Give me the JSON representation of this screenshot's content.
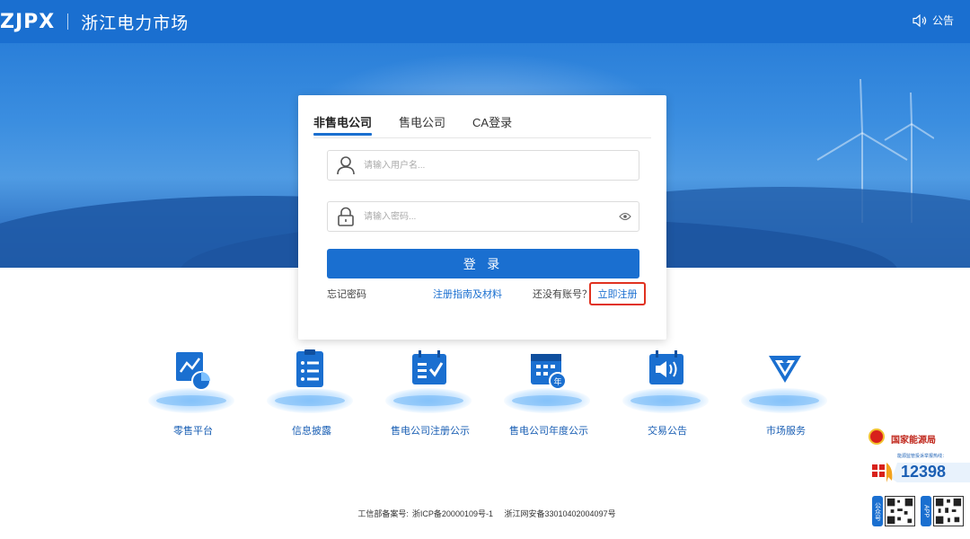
{
  "header": {
    "logo": "ZJPX",
    "site_name": "浙江电力市场",
    "notice_label": "公告"
  },
  "login": {
    "tabs": [
      {
        "label": "非售电公司",
        "active": true
      },
      {
        "label": "售电公司",
        "active": false
      },
      {
        "label": "CA登录",
        "active": false
      }
    ],
    "username_placeholder": "请输入用户名...",
    "password_placeholder": "请输入密码...",
    "submit_label": "登 录",
    "forgot_label": "忘记密码",
    "guide_label": "注册指南及材料",
    "no_account_label": "还没有账号？",
    "register_label": "立即注册"
  },
  "features": [
    {
      "label": "零售平台",
      "icon": "chart-pie-icon"
    },
    {
      "label": "信息披露",
      "icon": "clipboard-list-icon"
    },
    {
      "label": "售电公司注册公示",
      "icon": "checklist-icon"
    },
    {
      "label": "售电公司年度公示",
      "icon": "calendar-year-icon"
    },
    {
      "label": "交易公告",
      "icon": "speaker-icon"
    },
    {
      "label": "市场服务",
      "icon": "service-badge-icon"
    }
  ],
  "footer": {
    "icp_label": "工信部备案号:",
    "icp_value": "浙ICP备20000109号-1",
    "police_value": "浙江网安备33010402004097号"
  },
  "nea_widget": {
    "name": "国家能源局",
    "hotline_label": "能源监管投诉举报热线：",
    "hotline": "12398",
    "qr_tag_1": "公众号",
    "qr_tag_2": "APP"
  },
  "colors": {
    "primary": "#1a6fd0",
    "register_highlight": "#e0311f"
  }
}
